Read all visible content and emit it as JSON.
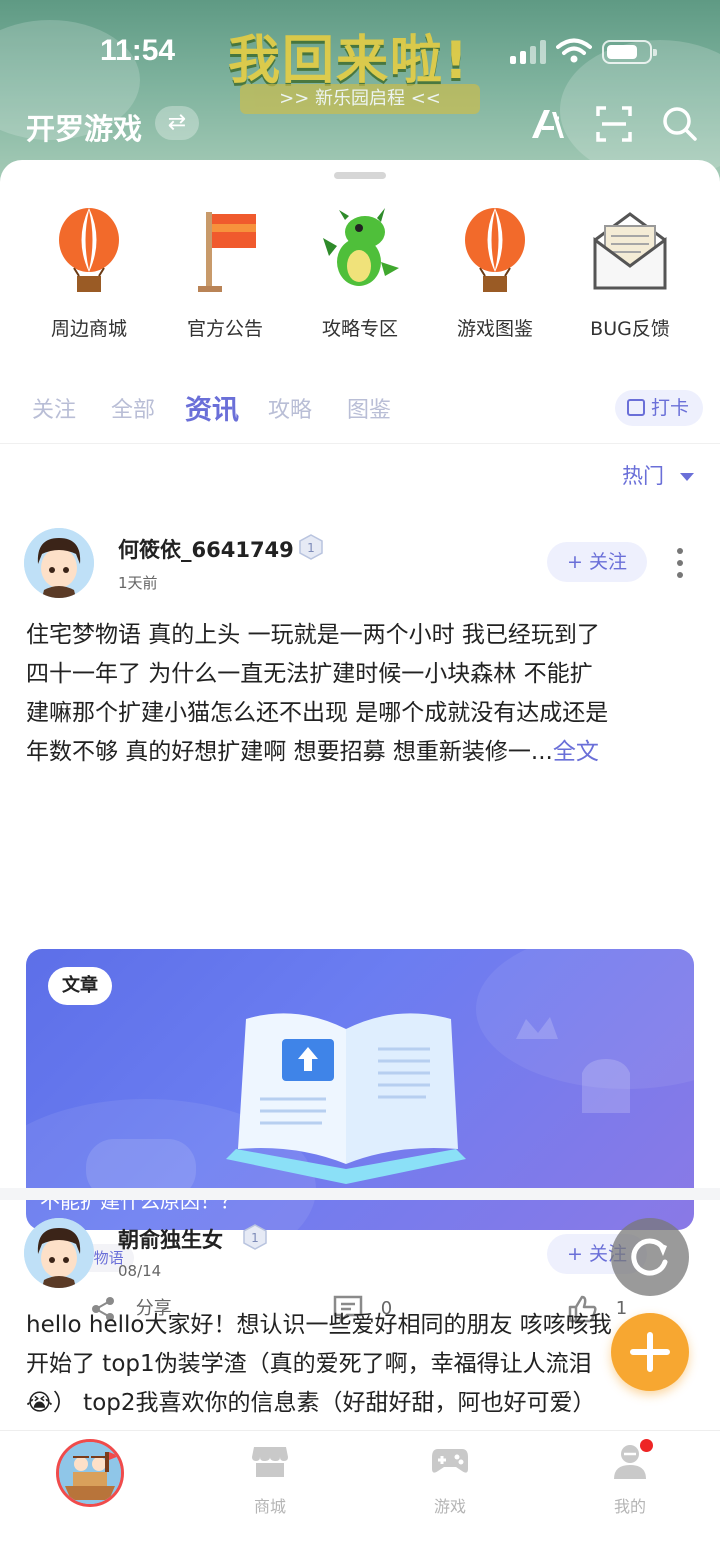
{
  "status_bar": {
    "time": "11:54"
  },
  "header": {
    "banner_title": "我回来啦!",
    "banner_subtitle": ">> 新乐园启程 <<",
    "app_title": "开罗游戏",
    "icons": [
      "switch-icon",
      "ai-icon",
      "scan-icon",
      "search-icon"
    ]
  },
  "quick_links": [
    {
      "label": "周边商城",
      "icon": "balloon-icon"
    },
    {
      "label": "官方公告",
      "icon": "flag-icon"
    },
    {
      "label": "攻略专区",
      "icon": "dragon-icon"
    },
    {
      "label": "游戏图鉴",
      "icon": "balloon-icon"
    },
    {
      "label": "BUG反馈",
      "icon": "envelope-icon"
    }
  ],
  "tabs": [
    {
      "label": "关注",
      "active": false
    },
    {
      "label": "全部",
      "active": false
    },
    {
      "label": "资讯",
      "active": true
    },
    {
      "label": "攻略",
      "active": false
    },
    {
      "label": "图鉴",
      "active": false
    }
  ],
  "checkin_label": "打卡",
  "sort_label": "热门",
  "posts": [
    {
      "username": "何筱依_6641749",
      "level": "1",
      "time": "1天前",
      "follow_label": "关注",
      "text_lines": [
        "住宅梦物语 真的上头 一玩就是一两个小时 我已经玩到了",
        "四十一年了 为什么一直无法扩建时候一小块森林 不能扩",
        "建嘛那个扩建小猫怎么还不出现 是哪个成就没有达成还是",
        "年数不够 真的好想扩建啊 想要招募 想重新装修一..."
      ],
      "full_text_label": "全文",
      "card_badge": "文章",
      "card_title": "不能扩建什么原因！？",
      "tag": "#住宅梦物语",
      "share_label": "分享",
      "comments": "0",
      "likes": "1"
    },
    {
      "username": "朝俞独生女",
      "level": "1",
      "time": "08/14",
      "follow_label": "关注",
      "text_lines": [
        "hello hello大家好！想认识一些爱好相同的朋友 咳咳咳我",
        "开始了 top1伪装学渣（真的爱死了啊，幸福得让人流泪",
        "😭） top2我喜欢你的信息素（好甜好甜，阿也好可爱）"
      ]
    }
  ],
  "bottom_nav": [
    {
      "label": "",
      "icon": "home-game-icon",
      "active": true
    },
    {
      "label": "商城",
      "icon": "shop-icon"
    },
    {
      "label": "游戏",
      "icon": "gamepad-icon"
    },
    {
      "label": "我的",
      "icon": "profile-icon",
      "badge": true
    }
  ],
  "colors": {
    "accent": "#6a6fd8",
    "fab": "#f7a731",
    "badge_dot": "#ee2525"
  }
}
